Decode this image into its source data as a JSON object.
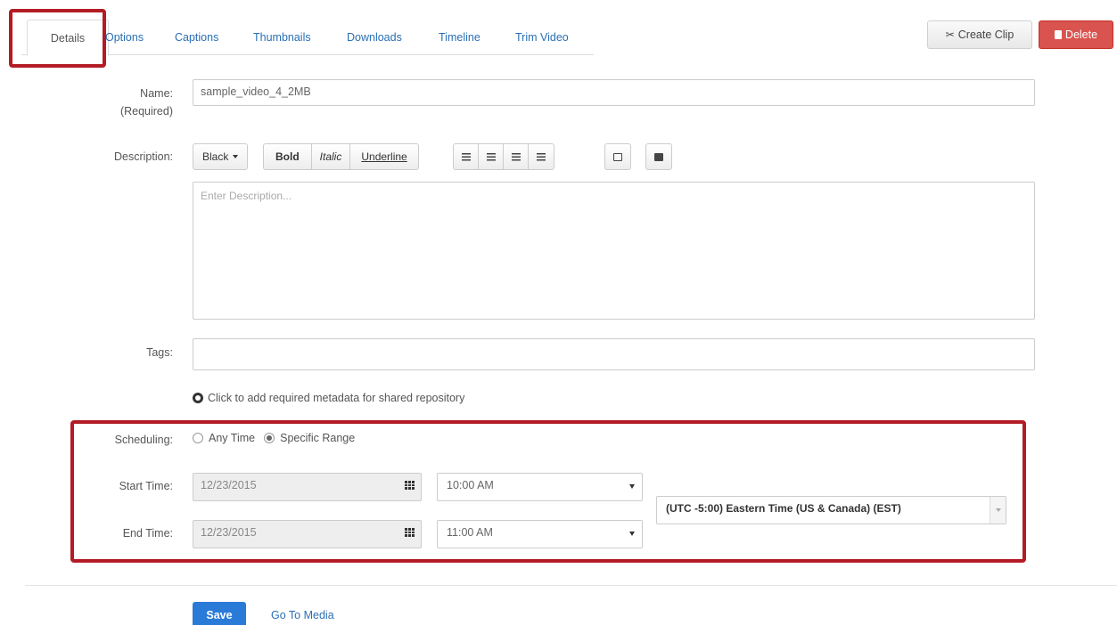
{
  "tabs": [
    {
      "label": "Details",
      "active": true
    },
    {
      "label": "Options"
    },
    {
      "label": "Captions"
    },
    {
      "label": "Thumbnails"
    },
    {
      "label": "Downloads"
    },
    {
      "label": "Timeline"
    },
    {
      "label": "Trim Video"
    }
  ],
  "header_actions": {
    "create_clip": "Create Clip",
    "delete": "Delete"
  },
  "form": {
    "name_label": "Name:",
    "name_required": "(Required)",
    "name_value": "sample_video_4_2MB",
    "description_label": "Description:",
    "description_placeholder": "Enter Description...",
    "tags_label": "Tags:",
    "tags_value": "",
    "metadata_link": "Click to add required metadata for shared repository"
  },
  "editor_toolbar": {
    "color": "Black",
    "bold": "Bold",
    "italic": "Italic",
    "underline": "Underline",
    "icons": [
      "unordered-list-icon",
      "ordered-list-icon",
      "outdent-icon",
      "indent-icon",
      "link-icon",
      "image-icon"
    ]
  },
  "scheduling": {
    "label": "Scheduling:",
    "options": [
      {
        "label": "Any Time",
        "selected": false
      },
      {
        "label": "Specific Range",
        "selected": true
      }
    ],
    "start_label": "Start Time:",
    "start_date": "12/23/2015",
    "start_time": "10:00 AM",
    "end_label": "End Time:",
    "end_date": "12/23/2015",
    "end_time": "11:00 AM",
    "timezone": "(UTC -5:00) Eastern Time (US & Canada) (EST)"
  },
  "footer": {
    "save": "Save",
    "go_to_media": "Go To Media"
  },
  "colors": {
    "highlight": "#b31c24",
    "link": "#2a6fb5",
    "primary": "#2a7bd8",
    "danger": "#d9534f"
  }
}
